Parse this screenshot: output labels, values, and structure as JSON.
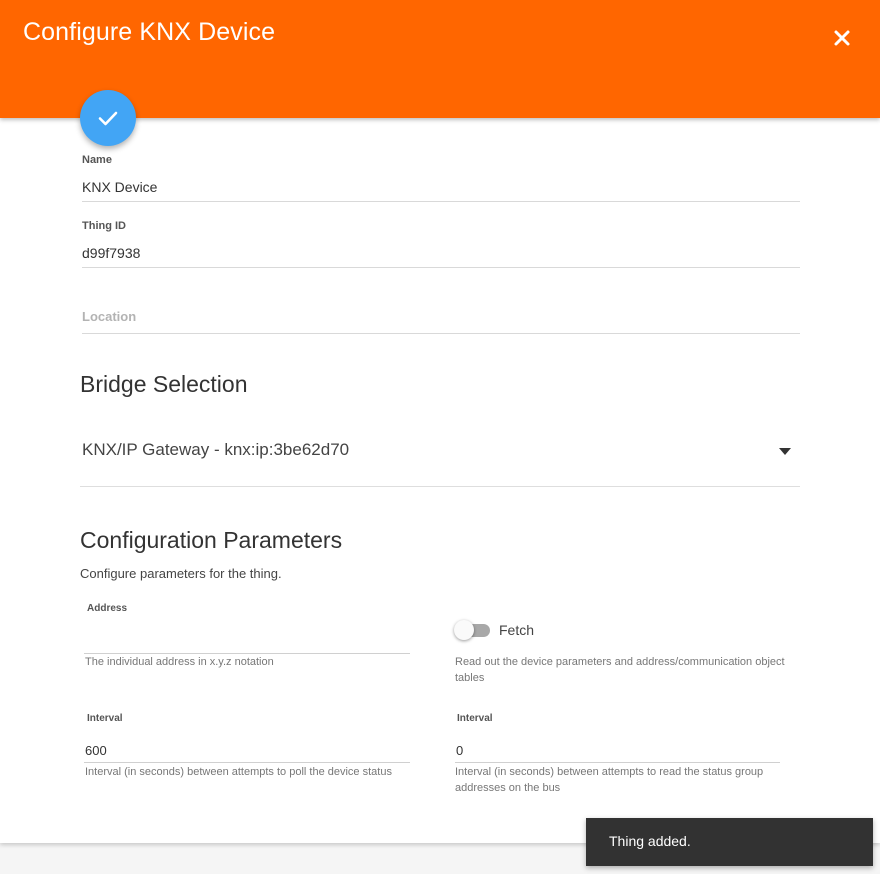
{
  "header": {
    "title": "Configure KNX Device",
    "background_color": "#ff6600",
    "close_icon": "close-icon"
  },
  "fab": {
    "icon": "check-icon",
    "color": "#42a5f5"
  },
  "fields": {
    "name": {
      "label": "Name",
      "value": "KNX Device"
    },
    "thing_id": {
      "label": "Thing ID",
      "value": "d99f7938"
    },
    "location": {
      "label": "Location",
      "value": ""
    }
  },
  "bridge": {
    "title": "Bridge Selection",
    "selected": "KNX/IP Gateway - knx:ip:3be62d70"
  },
  "config": {
    "title": "Configuration Parameters",
    "subtitle": "Configure parameters for the thing.",
    "address": {
      "label": "Address",
      "value": "",
      "hint": "The individual address in x.y.z notation"
    },
    "fetch": {
      "label": "Fetch",
      "checked": false,
      "hint": "Read out the device parameters and address/communication object tables"
    },
    "interval_poll": {
      "label": "Interval",
      "value": "600",
      "hint": "Interval (in seconds) between attempts to poll the device status"
    },
    "interval_read": {
      "label": "Interval",
      "value": "0",
      "hint": "Interval (in seconds) between attempts to read the status group addresses on the bus"
    }
  },
  "snackbar": {
    "message": "Thing added."
  }
}
